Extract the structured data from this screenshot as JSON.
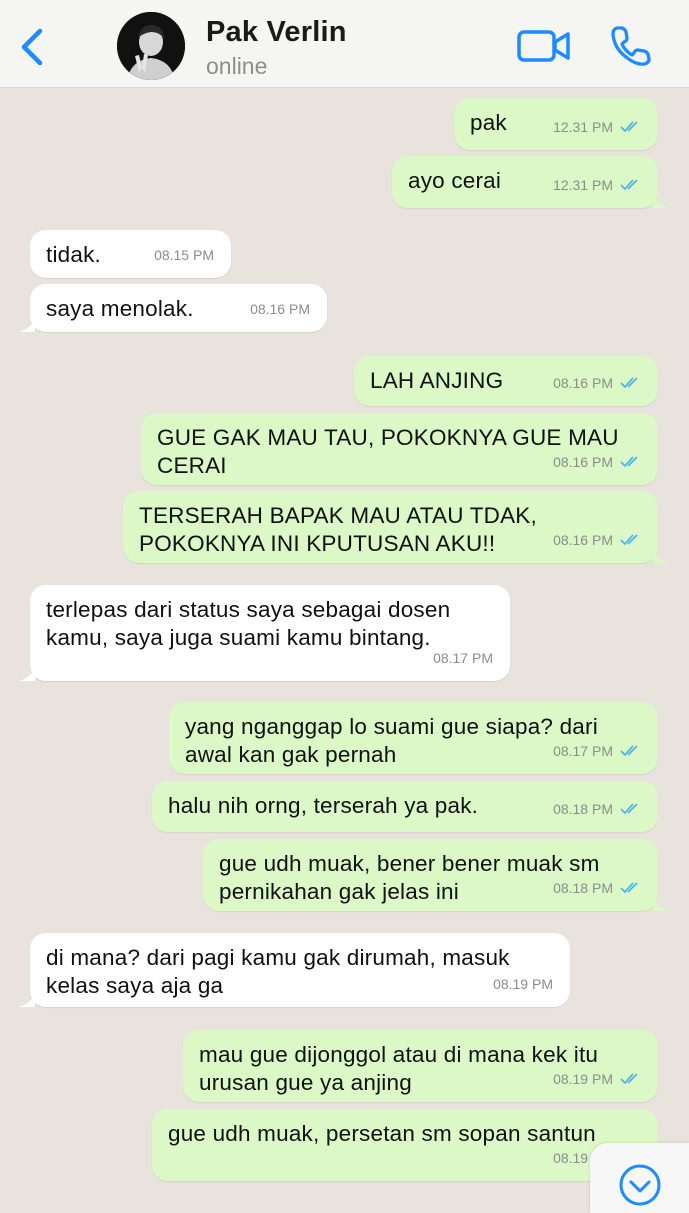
{
  "header": {
    "back_icon": "chevron-left-icon",
    "contact_name": "Pak Verlin",
    "status": "online",
    "video_icon": "video-camera-icon",
    "call_icon": "phone-icon"
  },
  "colors": {
    "outgoing_bubble": "#dcf8c6",
    "incoming_bubble": "#ffffff",
    "chat_background": "#e8e4dd",
    "accent": "#1a8cff",
    "read_ticks": "#4fb6ec"
  },
  "messages": [
    {
      "dir": "out",
      "lines": [
        "pak"
      ],
      "time": "12.31 PM"
    },
    {
      "dir": "out",
      "lines": [
        "ayo cerai"
      ],
      "time": "12.31 PM"
    },
    {
      "dir": "in",
      "lines": [
        "tidak."
      ],
      "time": "08.15 PM"
    },
    {
      "dir": "in",
      "lines": [
        "saya menolak."
      ],
      "time": "08.16 PM"
    },
    {
      "dir": "out",
      "lines": [
        "LAH ANJING"
      ],
      "time": "08.16 PM"
    },
    {
      "dir": "out",
      "lines": [
        "GUE GAK MAU TAU, POKOKNYA GUE MAU",
        "CERAI"
      ],
      "time": "08.16 PM"
    },
    {
      "dir": "out",
      "lines": [
        "TERSERAH BAPAK MAU ATAU TDAK,",
        "POKOKNYA INI KPUTUSAN AKU!!"
      ],
      "time": "08.16 PM"
    },
    {
      "dir": "in",
      "lines": [
        "terlepas dari status saya sebagai dosen",
        "kamu, saya juga suami kamu bintang."
      ],
      "time": "08.17 PM"
    },
    {
      "dir": "out",
      "lines": [
        "yang nganggap lo suami gue siapa? dari",
        "awal kan gak pernah"
      ],
      "time": "08.17 PM"
    },
    {
      "dir": "out",
      "lines": [
        "halu nih orng, terserah ya pak."
      ],
      "time": "08.18 PM"
    },
    {
      "dir": "out",
      "lines": [
        "gue udh muak, bener bener muak sm",
        "pernikahan gak jelas ini"
      ],
      "time": "08.18 PM"
    },
    {
      "dir": "in",
      "lines": [
        "di mana? dari pagi kamu gak dirumah, masuk",
        "kelas saya aja ga"
      ],
      "time": "08.19 PM"
    },
    {
      "dir": "out",
      "lines": [
        "mau gue dijonggol atau di mana kek itu",
        "urusan gue ya anjing"
      ],
      "time": "08.19 PM"
    },
    {
      "dir": "out",
      "lines": [
        "gue udh muak, persetan sm sopan santun"
      ],
      "time": "08.19 PM"
    }
  ],
  "scroll_down_icon": "chevron-down-circle-icon"
}
